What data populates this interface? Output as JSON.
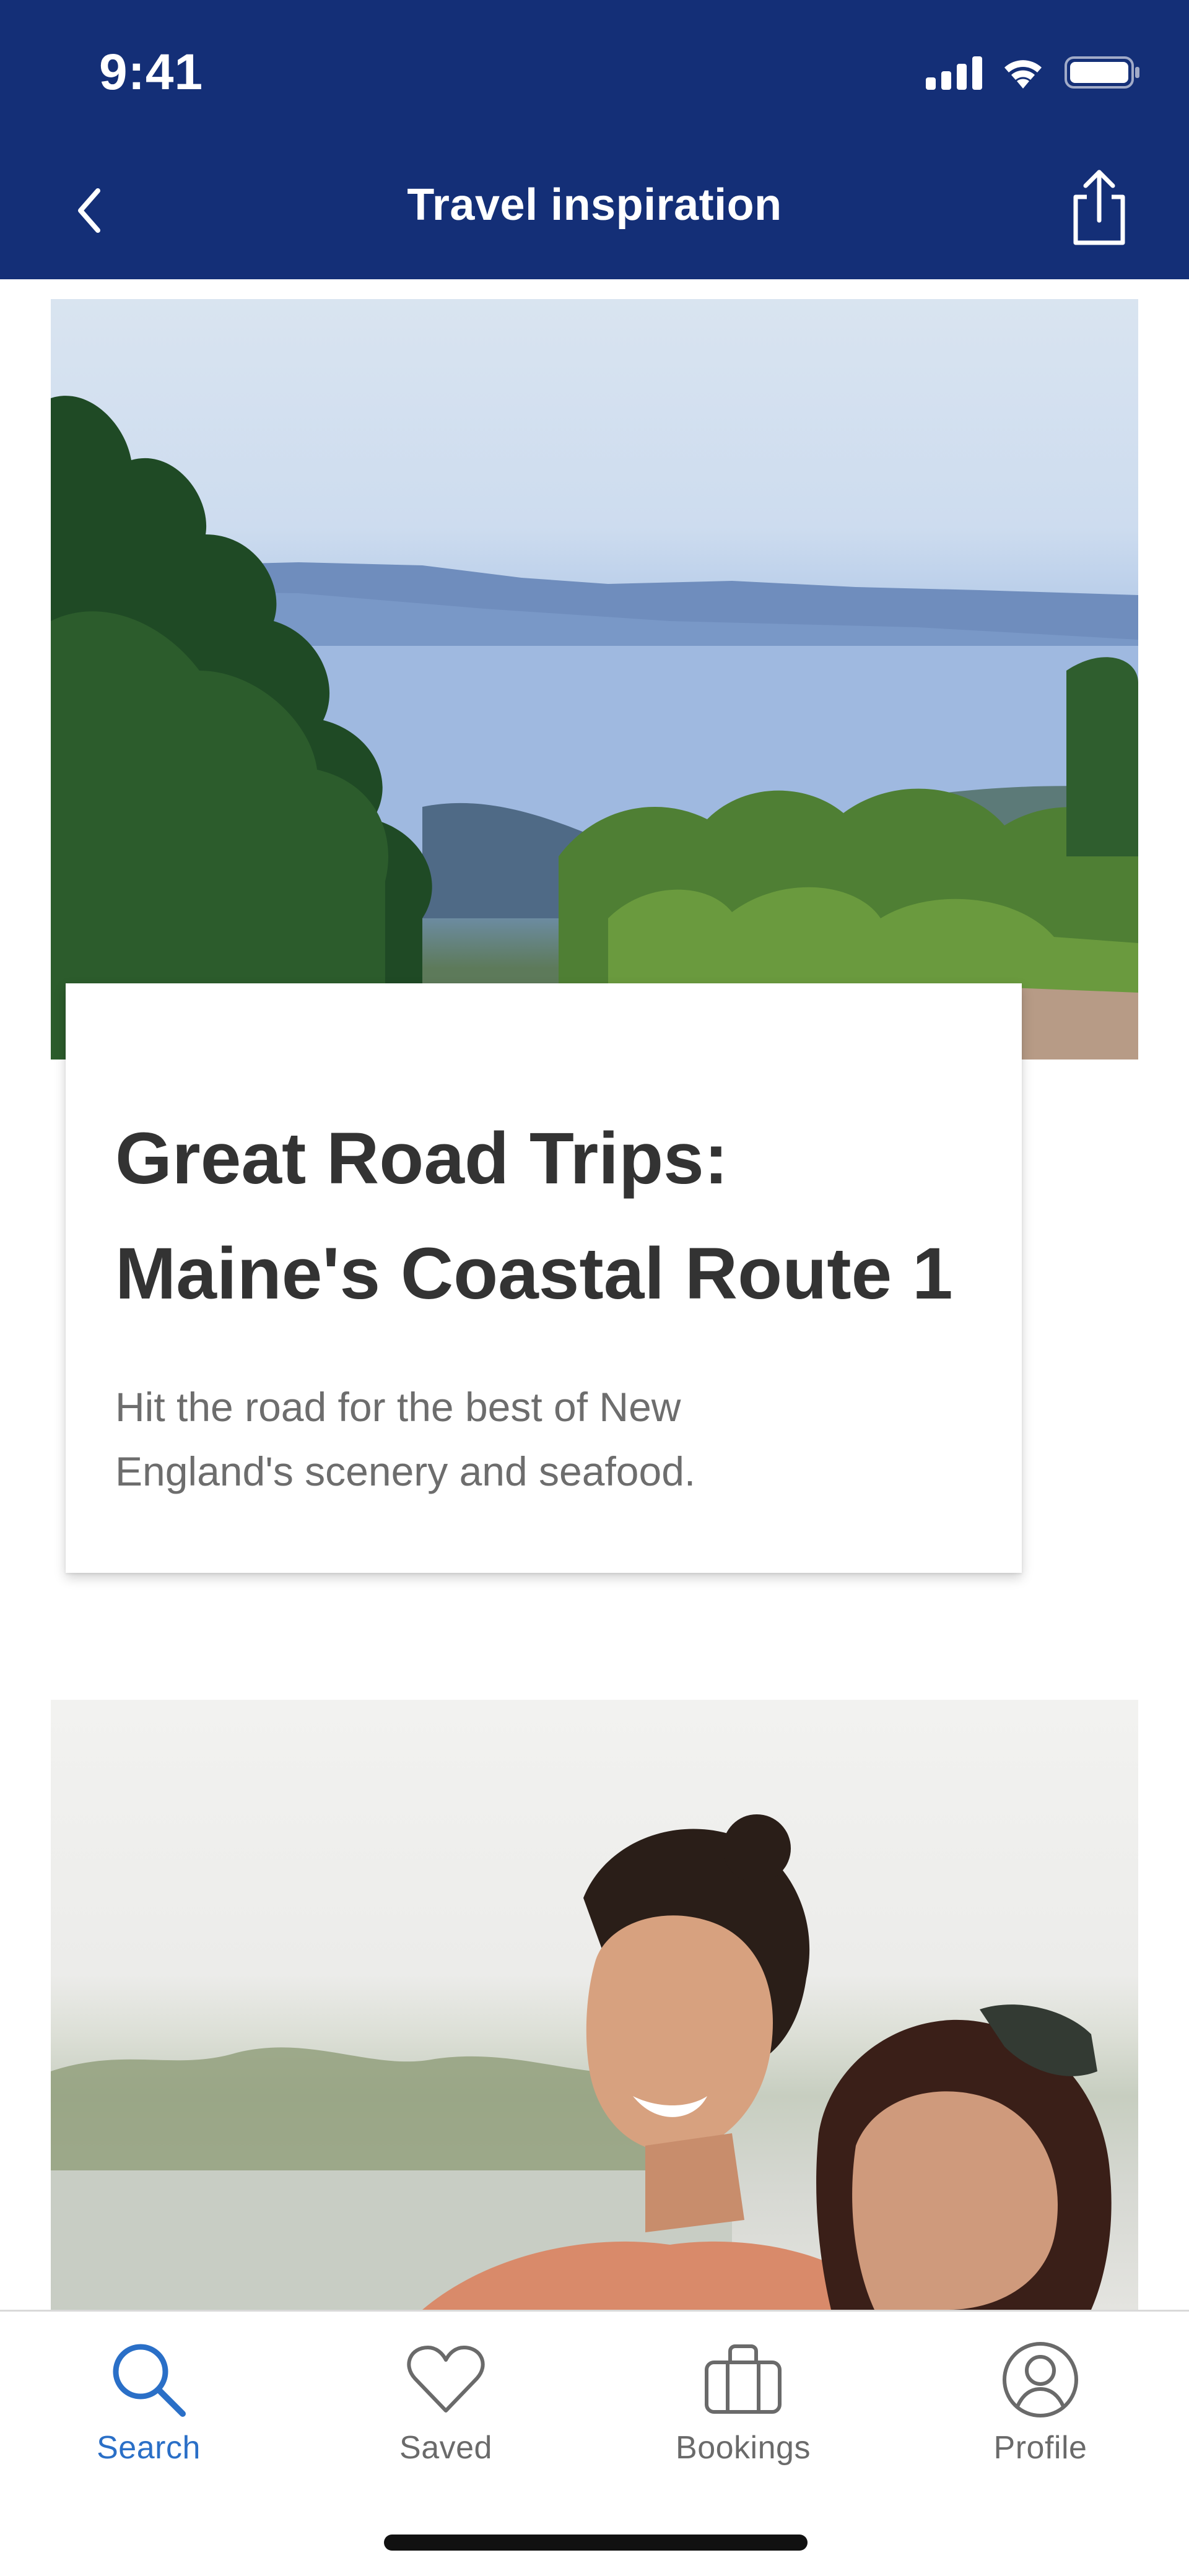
{
  "status_bar": {
    "time": "9:41"
  },
  "header": {
    "title": "Travel inspiration"
  },
  "articles": [
    {
      "title_line1": "Great Road Trips:",
      "title_line2": "Maine's Coastal Route 1",
      "subtitle_line1": "Hit the road for the best of New",
      "subtitle_line2": "England's scenery and seafood."
    }
  ],
  "tabbar": {
    "active_color": "#2a6fc7",
    "tabs": [
      {
        "label": "Search",
        "icon": "search-icon",
        "active": true
      },
      {
        "label": "Saved",
        "icon": "heart-icon",
        "active": false
      },
      {
        "label": "Bookings",
        "icon": "briefcase-icon",
        "active": false
      },
      {
        "label": "Profile",
        "icon": "profile-icon",
        "active": false
      }
    ]
  },
  "colors": {
    "header_bg": "#142f77",
    "title_text": "#333333",
    "subtitle_text": "#6d6d6d"
  }
}
